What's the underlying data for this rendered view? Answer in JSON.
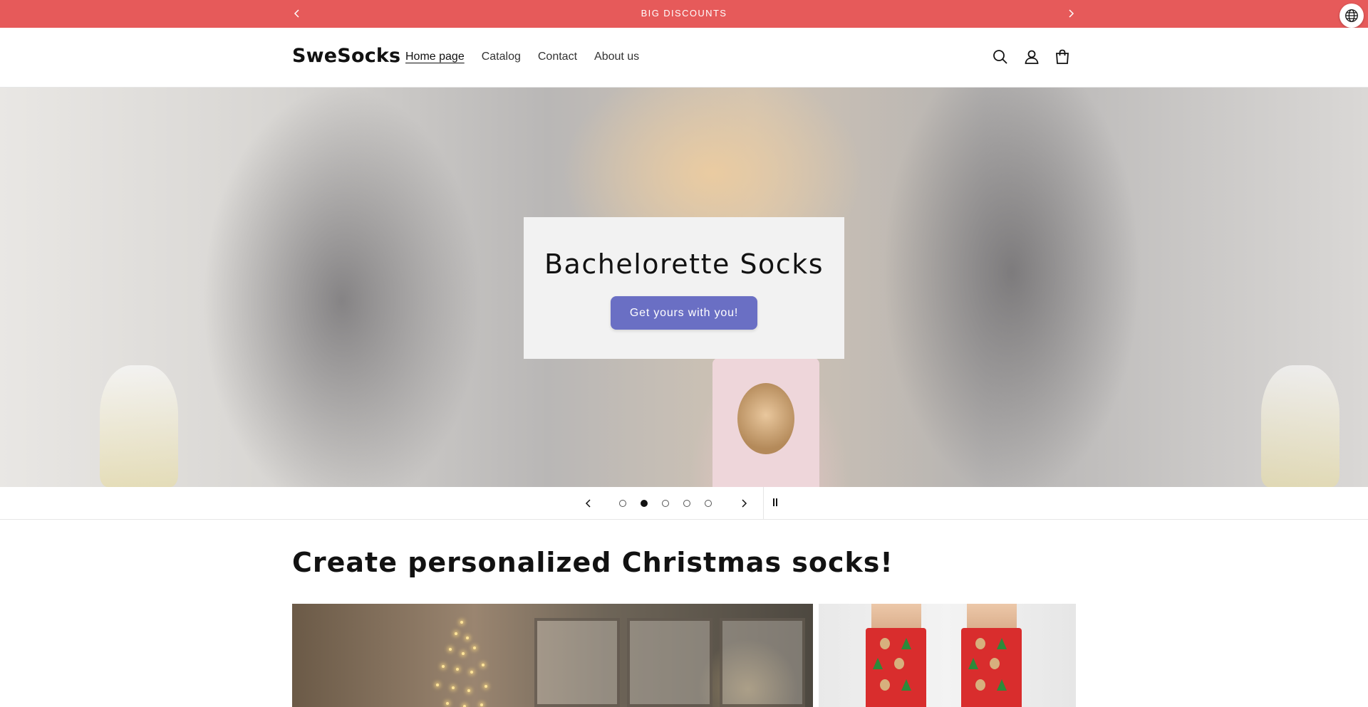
{
  "announcement": {
    "text": "BIG DISCOUNTS",
    "prev_icon": "chevron-left-icon",
    "next_icon": "chevron-right-icon"
  },
  "language_icon": "globe-icon",
  "header": {
    "logo": "SweSocks",
    "nav": [
      "Home page",
      "Catalog",
      "Contact",
      "About us"
    ],
    "active_nav": "Home page",
    "icons": [
      "search-icon",
      "account-icon",
      "cart-icon"
    ]
  },
  "hero": {
    "title": "Bachelorette Socks",
    "button_label": "Get yours with you!",
    "button_color": "#6a6fc4"
  },
  "slider": {
    "slide_count": 5,
    "active_slide": 2
  },
  "section": {
    "title": "Create personalized Christmas socks!"
  },
  "colors": {
    "announcement_bg": "#e65a5a",
    "text": "#121212"
  }
}
